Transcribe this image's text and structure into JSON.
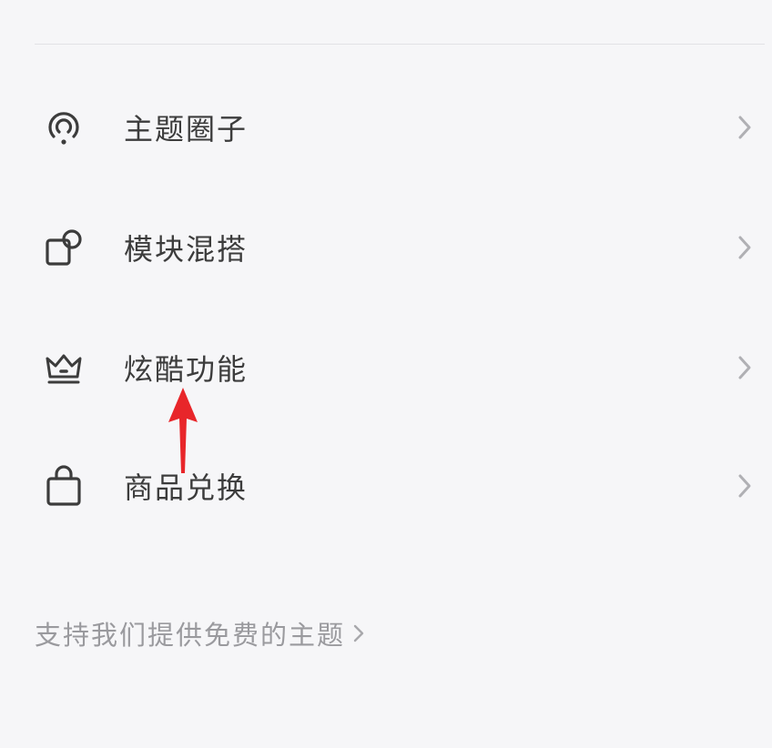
{
  "menu": {
    "items": [
      {
        "label": "主题圈子",
        "icon": "podcast-signal-icon"
      },
      {
        "label": "模块混搭",
        "icon": "square-circle-shapes-icon"
      },
      {
        "label": "炫酷功能",
        "icon": "crown-icon"
      },
      {
        "label": "商品兑换",
        "icon": "shopping-bag-icon"
      }
    ]
  },
  "footer": {
    "support_label": "支持我们提供免费的主题"
  },
  "colors": {
    "background": "#f6f6f8",
    "label": "#3c3c3c",
    "muted": "#9a9a9e",
    "chevron": "#b0b0b4",
    "annotation": "#e8262a"
  }
}
